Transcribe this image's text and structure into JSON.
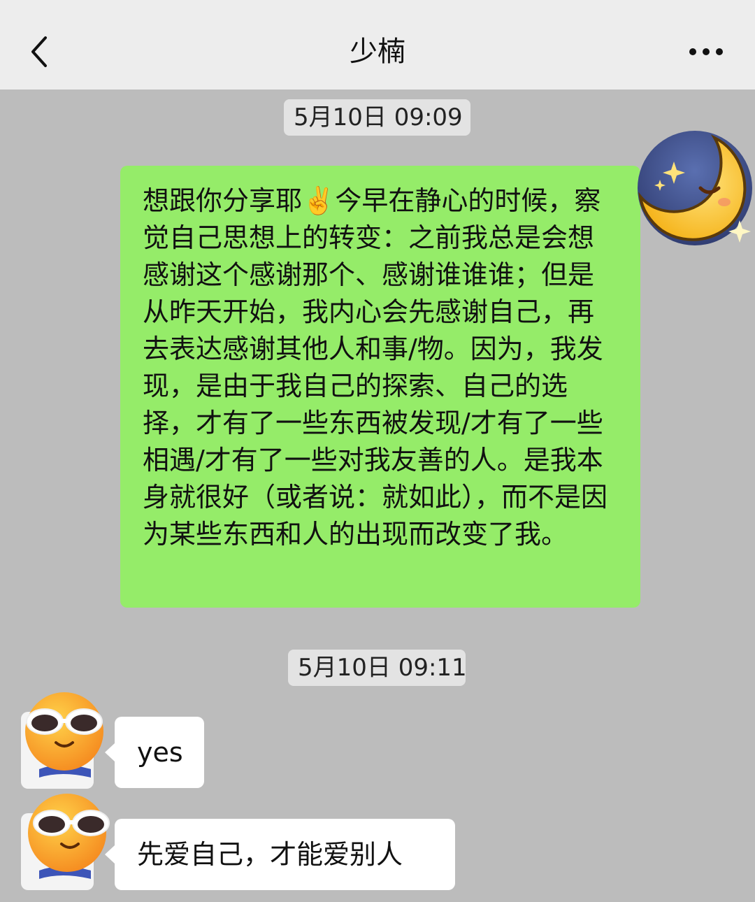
{
  "header": {
    "title": "少楠",
    "back_icon": "chevron-left-icon",
    "more_icon": "more-dots-icon"
  },
  "messages": {
    "timestamp_1": "5月10日 09:09",
    "outgoing_text": "想跟你分享耶✌️今早在静心的时候，察觉自己思想上的转变：之前我总是会想感谢这个感谢那个、感谢谁谁谁；但是从昨天开始，我内心会先感谢自己，再去表达感谢其他人和事/物。因为，我发现，是由于我自己的探索、自己的选择，才有了一些东西被发现/才有了一些相遇/才有了一些对我友善的人。是我本身就很好（或者说：就如此），而不是因为某些东西和人的出现而改变了我。",
    "timestamp_2": "5月10日 09:11",
    "incoming_1": "yes",
    "incoming_2": "先爱自己，才能爱别人"
  },
  "colors": {
    "outgoing_bubble": "#95ec69",
    "incoming_bubble": "#ffffff",
    "chat_background": "#bcbcbc",
    "header_background": "#ededed"
  },
  "avatars": {
    "self": "crescent-moon-sleeping-avatar",
    "other": "sunglasses-face-avatar"
  }
}
